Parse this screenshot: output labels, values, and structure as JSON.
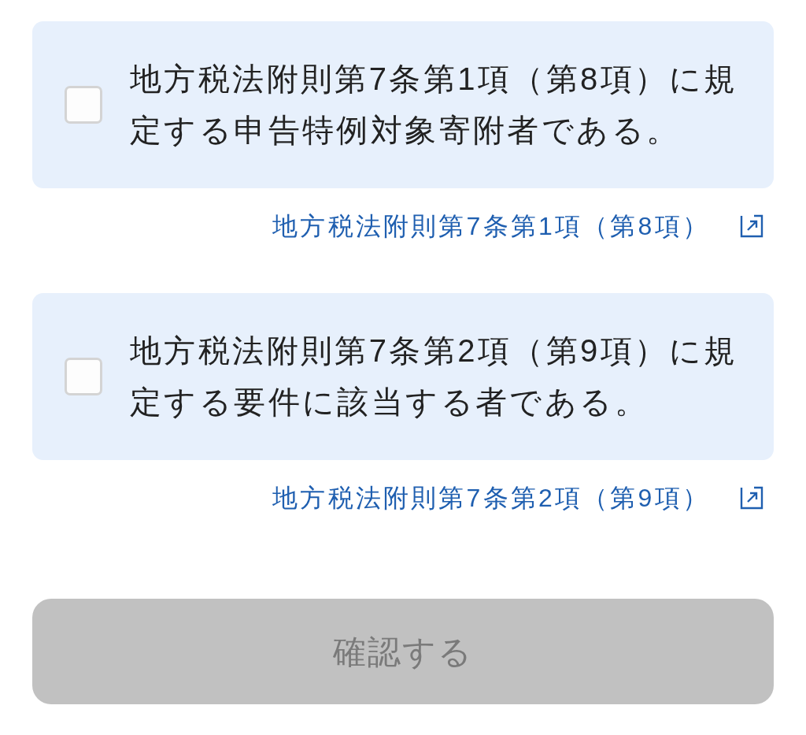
{
  "items": [
    {
      "label": "地方税法附則第7条第1項（第8項）に規定する申告特例対象寄附者である。",
      "checked": false,
      "link": "地方税法附則第7条第1項（第8項）"
    },
    {
      "label": "地方税法附則第7条第2項（第9項）に規定する要件に該当する者である。",
      "checked": false,
      "link": "地方税法附則第7条第2項（第9項）"
    }
  ],
  "button": {
    "label": "確認する",
    "disabled": true
  }
}
